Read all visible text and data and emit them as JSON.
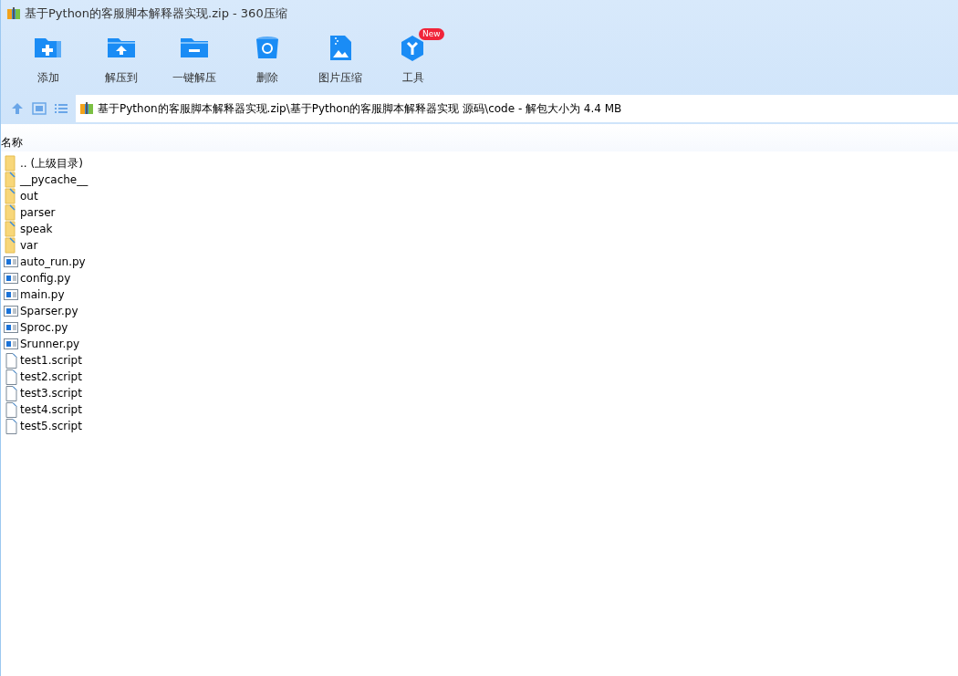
{
  "window": {
    "title": "基于Python的客服脚本解释器实现.zip - 360压缩"
  },
  "toolbar": [
    {
      "kind": "add",
      "label": "添加"
    },
    {
      "kind": "extract",
      "label": "解压到"
    },
    {
      "kind": "oneclick",
      "label": "一键解压"
    },
    {
      "kind": "delete",
      "label": "删除"
    },
    {
      "kind": "image",
      "label": "图片压缩"
    },
    {
      "kind": "tools",
      "label": "工具",
      "badge": "New"
    }
  ],
  "address_bar": {
    "path": "基于Python的客服脚本解释器实现.zip\\基于Python的客服脚本解释器实现 源码\\code - 解包大小为 4.4 MB"
  },
  "file_list": {
    "columns": [
      "名称"
    ],
    "rows": [
      {
        "kind": "parent",
        "name": ".. (上级目录)"
      },
      {
        "kind": "folder",
        "name": "__pycache__"
      },
      {
        "kind": "folder",
        "name": "out"
      },
      {
        "kind": "folder",
        "name": "parser"
      },
      {
        "kind": "folder",
        "name": "speak"
      },
      {
        "kind": "folder",
        "name": "var"
      },
      {
        "kind": "py",
        "name": "auto_run.py"
      },
      {
        "kind": "py",
        "name": "config.py"
      },
      {
        "kind": "py",
        "name": "main.py"
      },
      {
        "kind": "py",
        "name": "Sparser.py"
      },
      {
        "kind": "py",
        "name": "Sproc.py"
      },
      {
        "kind": "py",
        "name": "Srunner.py"
      },
      {
        "kind": "script",
        "name": "test1.script"
      },
      {
        "kind": "script",
        "name": "test2.script"
      },
      {
        "kind": "script",
        "name": "test3.script"
      },
      {
        "kind": "script",
        "name": "test4.script"
      },
      {
        "kind": "script",
        "name": "test5.script"
      }
    ]
  }
}
